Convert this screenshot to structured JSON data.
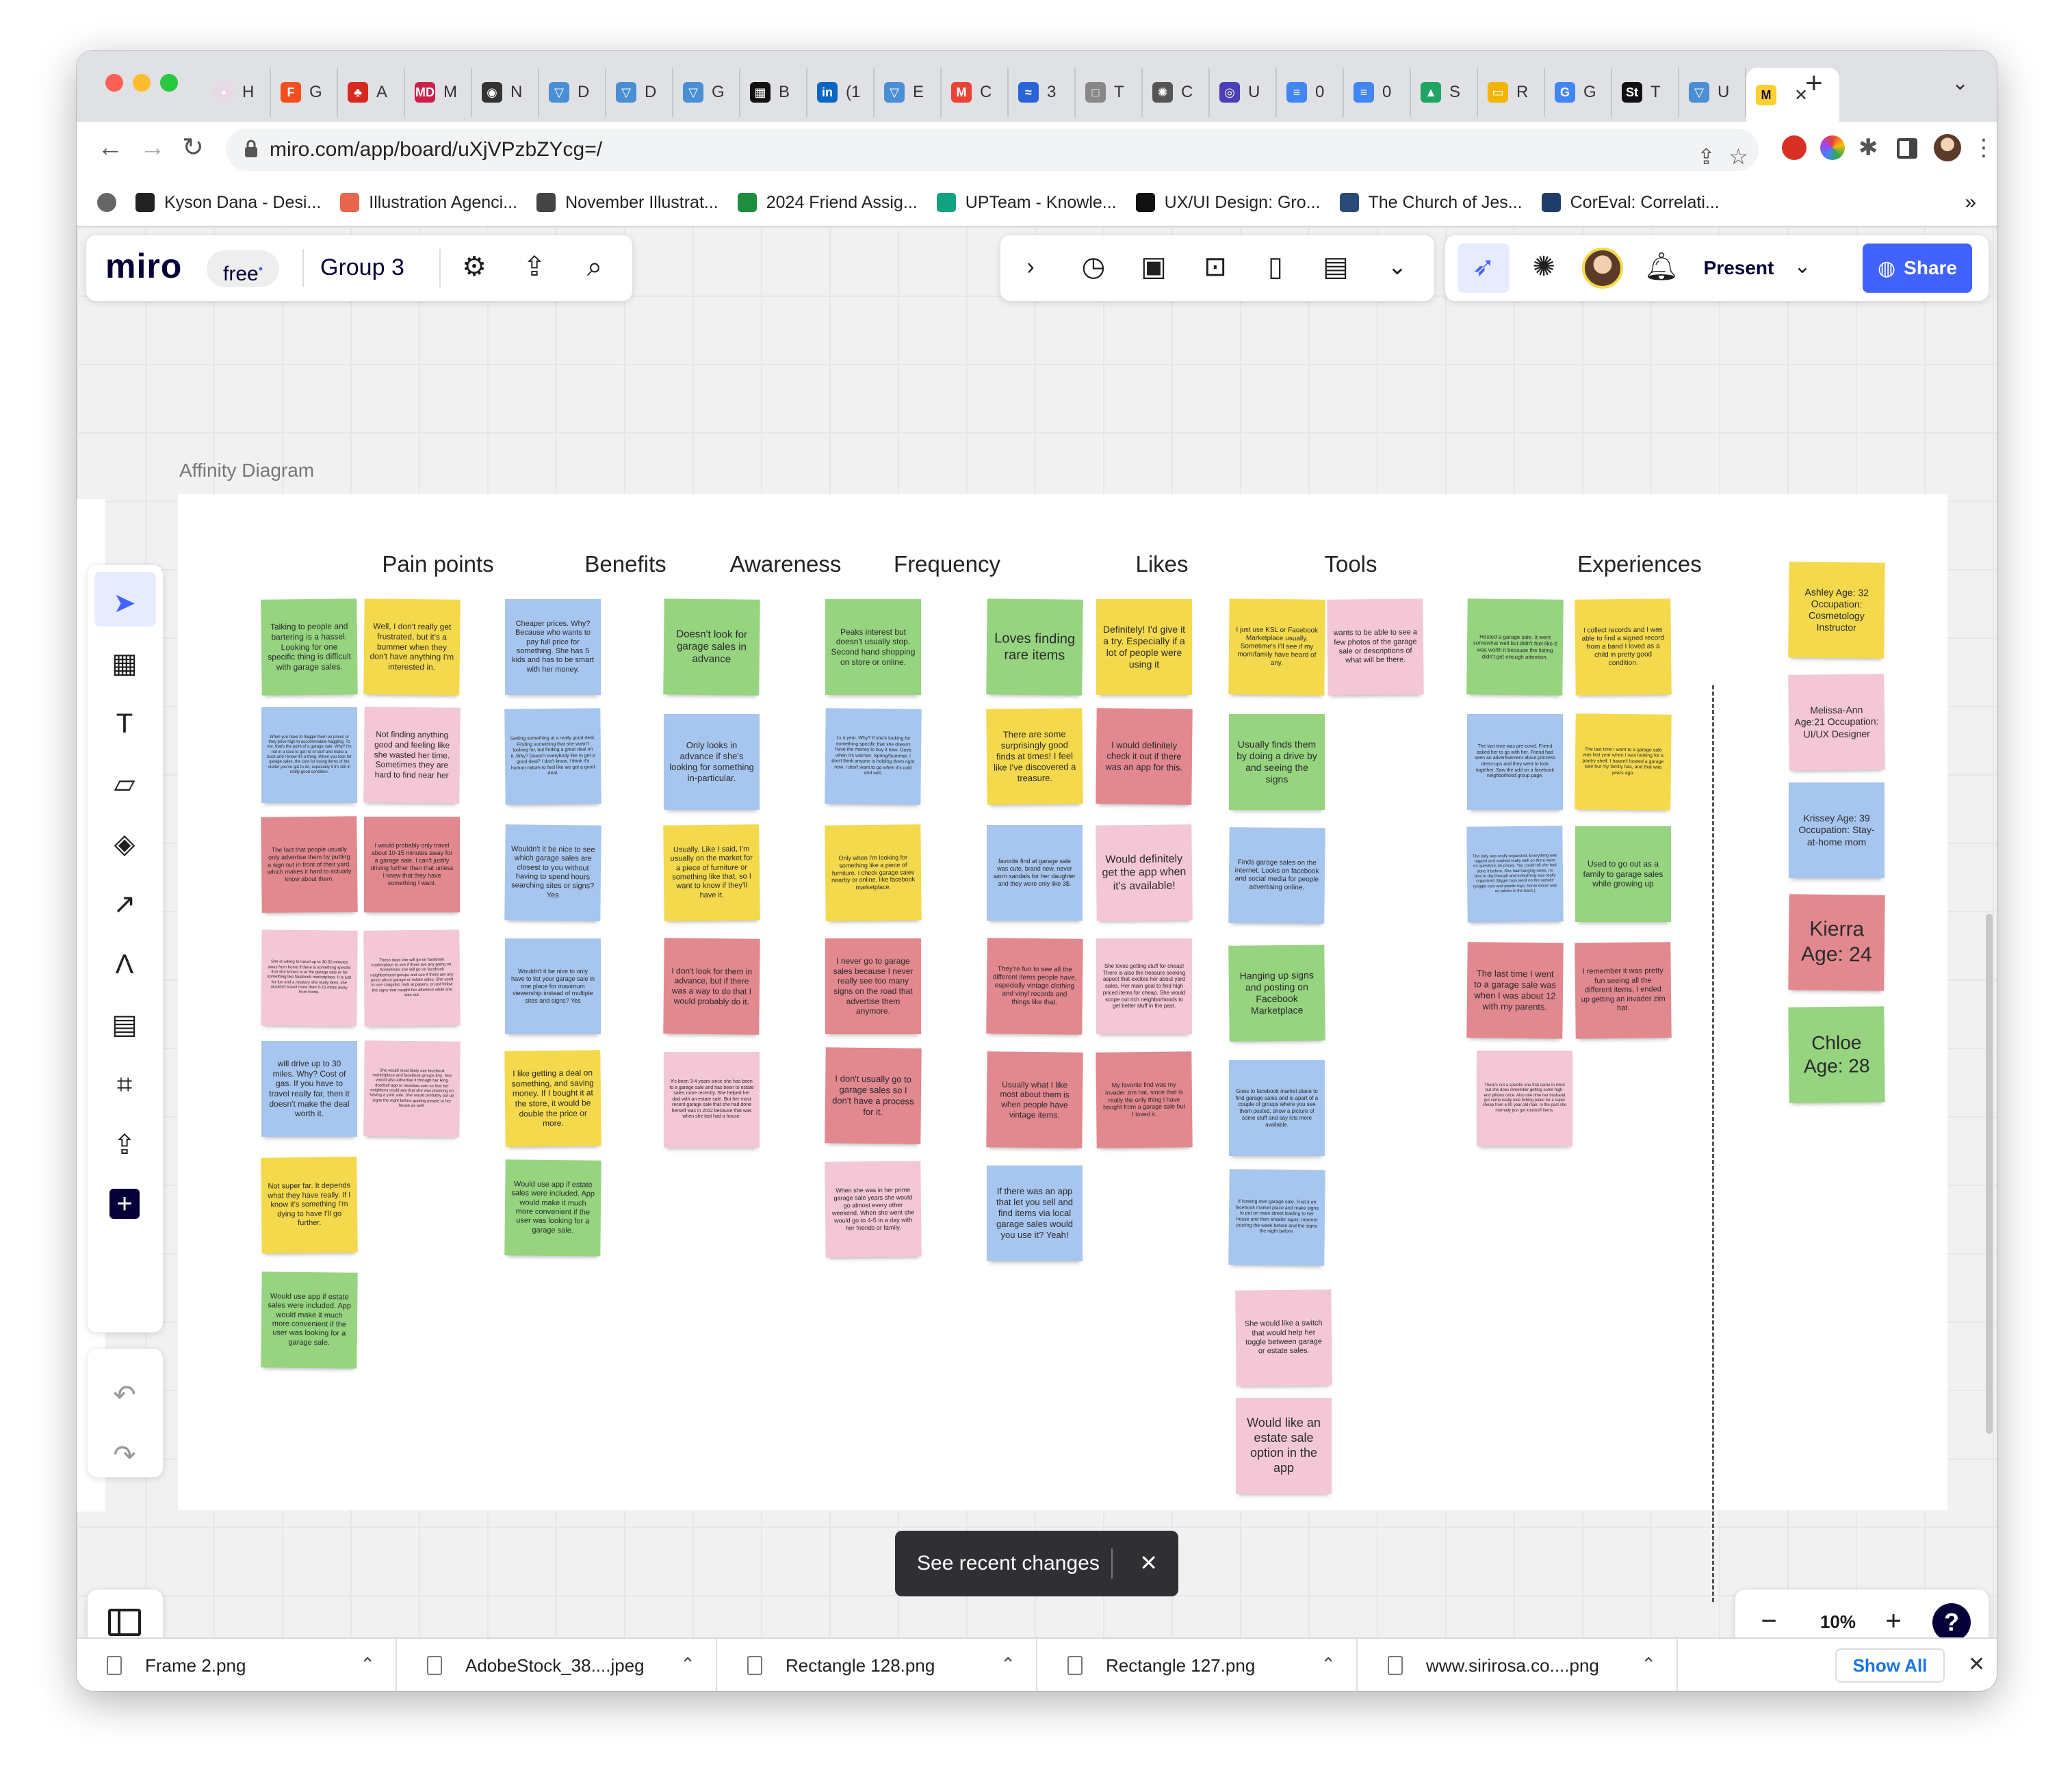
{
  "browser": {
    "tabs": [
      {
        "label": "H",
        "color": "#e7d9e8",
        "glyph": "▪"
      },
      {
        "label": "G",
        "color": "#f24e1e",
        "glyph": "F"
      },
      {
        "label": "A",
        "color": "#d52b1e",
        "glyph": "♣"
      },
      {
        "label": "M",
        "color": "#cc1f49",
        "glyph": "MD"
      },
      {
        "label": "N",
        "color": "#333333",
        "glyph": "◉"
      },
      {
        "label": "D",
        "color": "#4a8fd4",
        "glyph": "▽"
      },
      {
        "label": "D",
        "color": "#4a8fd4",
        "glyph": "▽"
      },
      {
        "label": "G",
        "color": "#4a8fd4",
        "glyph": "▽"
      },
      {
        "label": "B",
        "color": "#111111",
        "glyph": "▦"
      },
      {
        "label": "(1",
        "color": "#0a66c2",
        "glyph": "in"
      },
      {
        "label": "E",
        "color": "#4a8fd4",
        "glyph": "▽"
      },
      {
        "label": "C",
        "color": "#ea4335",
        "glyph": "M"
      },
      {
        "label": "3",
        "color": "#2864d8",
        "glyph": "≈"
      },
      {
        "label": "T",
        "color": "#888888",
        "glyph": "□"
      },
      {
        "label": "C",
        "color": "#555555",
        "glyph": "✺"
      },
      {
        "label": "U",
        "color": "#4b3fb6",
        "glyph": "◎"
      },
      {
        "label": "0",
        "color": "#4285f4",
        "glyph": "≡"
      },
      {
        "label": "0",
        "color": "#4285f4",
        "glyph": "≡"
      },
      {
        "label": "S",
        "color": "#1fa463",
        "glyph": "▲"
      },
      {
        "label": "R",
        "color": "#f4b400",
        "glyph": "▭"
      },
      {
        "label": "G",
        "color": "#4285f4",
        "glyph": "G"
      },
      {
        "label": "T",
        "color": "#111111",
        "glyph": "St"
      },
      {
        "label": "U",
        "color": "#4a8fd4",
        "glyph": "▽"
      }
    ],
    "url": "miro.com/app/board/uXjVPzbZYcg=/",
    "bookmarks": [
      {
        "label": "Kyson Dana - Desi...",
        "color": "#222222"
      },
      {
        "label": "Illustration Agenci...",
        "color": "#e8664d"
      },
      {
        "label": "November Illustrat...",
        "color": "#444444"
      },
      {
        "label": "2024 Friend Assig...",
        "color": "#1e8e3e"
      },
      {
        "label": "UPTeam - Knowle...",
        "color": "#11a37f"
      },
      {
        "label": "UX/UI Design: Gro...",
        "color": "#111111"
      },
      {
        "label": "The Church of Jes...",
        "color": "#2a4a7a"
      },
      {
        "label": "CorEval: Correlati...",
        "color": "#1f3d6b"
      }
    ]
  },
  "miro": {
    "logo": "miro",
    "plan": "free",
    "board_name": "Group 3",
    "present_label": "Present",
    "share_label": "Share",
    "share_color": "#4262ff",
    "zoom": "10%",
    "help": "?"
  },
  "board": {
    "frame_title": "Affinity Diagram",
    "columns": [
      "Pain points",
      "Benefits",
      "Awareness",
      "Frequency",
      "Likes",
      "Tools",
      "Experiences"
    ],
    "notes": [
      {
        "c": "g",
        "t": "Talking to people and bartering is a hassel. Looking for one specific thing is difficult with garage sales."
      },
      {
        "c": "y",
        "t": "Well, I don't really get frustrated, but it's a bummer when they don't have anything I'm interested in."
      },
      {
        "c": "b",
        "t": "When you have to haggle them on prices or they price high to accommodate haggling. To me, that's the point of a garage sale. Why? I'm not in a race to get rid of stuff and make a buck and I know it's a thing. When you look for garage sales, the cost for losing items of the clutter you've got to do, especially if it's still in really good condition."
      },
      {
        "c": "p",
        "t": "Not finding anything good and feeling like she wasted her time. Sometimes they are hard to find near her"
      },
      {
        "c": "r",
        "t": "The fact that people usually only advertise them by putting a sign out in front of their yard, which makes it hard to actually know about them."
      },
      {
        "c": "r",
        "t": "I would probably only travel about 10-15 minutes away for a garage sale, I can't justify driving further than that unless I knew that they have something I want."
      },
      {
        "c": "p",
        "t": "She is willing to travel up to 30-50 minutes away from home if there is something specific that she knows is at the garage sale or for something like facebook marketplace. It is just for fun and a mystery she really likes, she wouldn't travel more than 5-15 miles away from home."
      },
      {
        "c": "p",
        "t": "These days she will go on facebook marketplace to see if there are any going on. Sometimes she will go on facebook neighborhood groups and see if there are any posts about garage or estate sales. She used to use craigslist, look at papers, or just follow the signs that caught her attention while she was out."
      },
      {
        "c": "b",
        "t": "will drive up to 30 miles. Why? Cost of gas. If you have to travel really far, then it doesn't make the deal worth it."
      },
      {
        "c": "p",
        "t": "She would most likely use facebook marketplace and facebook groups first. She would also advertise it through her Ring doorbell app or nextdoor.com so that her neighbors could see that she was planning on having a yard sale. She would probably put up signs the night before guiding people to her house as well."
      },
      {
        "c": "y",
        "t": "Not super far. It depends what they have really. If I know it's something I'm dying to have I'll go further."
      },
      {
        "c": "g",
        "t": "Would use app if estate sales were included. App would make it much more convenient if the user was looking for a garage sale."
      },
      {
        "c": "b",
        "t": "Cheaper prices. Why? Because who wants to pay full price for something. She has 5 kids and has to be smart with her money."
      },
      {
        "c": "b",
        "t": "Getting something at a really good deal. Finding something that she wasn't looking for, but finding a great deal on it. Why? Doesn't everybody like to get a good deal? I don't know. I think it's human nature to feel like we got a good deal."
      },
      {
        "c": "b",
        "t": "Wouldn't it be nice to see which garage sales are closest to you without having to spend hours searching sites or signs? Yes"
      },
      {
        "c": "b",
        "t": "Wouldn't it be nice to only have to list your garage sale in one place for maximum viewership instead of multiple sites and signs? Yes"
      },
      {
        "c": "y",
        "t": "I like getting a deal on something, and saving money. If I bought it at the store, it would be double the price or more."
      },
      {
        "c": "g",
        "t": "Would use app if estate sales were included. App would make it much more convenient if the user was looking for a garage sale."
      },
      {
        "c": "g",
        "t": "Doesn't look for garage sales in advance"
      },
      {
        "c": "b",
        "t": "Only looks in advance if she's looking for something in-particular."
      },
      {
        "c": "y",
        "t": "Usually. Like I said, I'm usually on the market for a piece of furniture or something like that, so I want to know if they'll have it."
      },
      {
        "c": "r",
        "t": "I don't look for them in advance, but if there was a way to do that I would probably do it."
      },
      {
        "c": "p",
        "t": "It's been 3-4 years since she has been to a garage sale and has been to estate sales more recently. She helped her dad with an estate sale. But her most recent garage sale that she had done herself was in 2012 because that was when she last had a house."
      },
      {
        "c": "g",
        "t": "Peaks interest but doesn't usually stop. Second hand shopping on store or online."
      },
      {
        "c": "b",
        "t": "1x a year. Why? If she's looking for something specific that she doesn't have the money to buy it new. Goes when it's warmer. Spring/Summer. I don't think anyone is holding them right now. I don't want to go when it's cold and wet."
      },
      {
        "c": "y",
        "t": "Only when I'm looking for something like a piece of furniture. I check garage sales nearby or online, like facebook marketplace."
      },
      {
        "c": "r",
        "t": "I never go to garage sales because I never really see too many signs on the road that advertise them anymore."
      },
      {
        "c": "r",
        "t": "I don't usually go to garage sales so I don't have a process for it."
      },
      {
        "c": "p",
        "t": "When she was in her prime garage sale years she would go almost every other weekend. When she went she would go to 4-5 in a day with her friends or family."
      },
      {
        "c": "g",
        "t": "Loves finding rare items"
      },
      {
        "c": "y",
        "t": "Definitely! I'd give it a try. Especially if a lot of people were using it"
      },
      {
        "c": "y",
        "t": "There are some surprisingly good finds at times! I feel like I've discovered a treasure."
      },
      {
        "c": "r",
        "t": "I would definitely check it out if there was an app for this."
      },
      {
        "c": "b",
        "t": "favorite find at garage sale was cute, brand new, never worn sandals for her daughter and they were only like 3$."
      },
      {
        "c": "p",
        "t": "Would definitely get the app when it's available!"
      },
      {
        "c": "r",
        "t": "They're fun to see all the different items people have, especially vintage clothing and vinyl records and things like that."
      },
      {
        "c": "p",
        "t": "She loves getting stuff for cheap! There is also the treasure seeking aspect that excites her about yard sales. Her main goal to find high priced items for cheap. She would scope out rich neighborhoods to get better stuff in the past."
      },
      {
        "c": "r",
        "t": "Usually what I like most about them is when people have vintage items."
      },
      {
        "c": "r",
        "t": "My favorite find was my invader zim hat, since that is really the only thing I have bought from a garage sale but I loved it."
      },
      {
        "c": "b",
        "t": "If there was an app that let you sell and find items via local garage sales would you use it? Yeah!"
      },
      {
        "c": "y",
        "t": "I just use KSL or Facebook Marketplace usually. Sometime's I'll see if my mom/family have heard of any."
      },
      {
        "c": "p",
        "t": "wants to be able to see a few photos of the garage sale or descriptions of what will be there."
      },
      {
        "c": "g",
        "t": "Usually finds them by doing a drive by and seeing the signs"
      },
      {
        "c": "b",
        "t": "Finds garage sales on the internet. Looks on facebook and social media for people advertising online."
      },
      {
        "c": "g",
        "t": "Hanging up signs and posting on Facebook Marketplace"
      },
      {
        "c": "b",
        "t": "Goes to facebook market place to find garage sales and is apart of a couple of groups where you see them posted, show a picture of some stuff and say lots more available."
      },
      {
        "c": "b",
        "t": "If hosting own garage sale. First it on facebook market place and make signs to put on main street leading to her house and then smaller signs. Internet posting the week before and the signs the night before."
      },
      {
        "c": "p",
        "t": "She would like a switch that would help her toggle between garage or estate sales."
      },
      {
        "c": "p",
        "t": "Would like an estate sale option in the app"
      },
      {
        "c": "g",
        "t": "Hosted a garage sale. It went somewhat well but didn't feel like it was worth it because the listing didn't get enough attention."
      },
      {
        "c": "y",
        "t": "I collect records and I was able to find a signed record from a band I loved as a child in pretty good condition."
      },
      {
        "c": "b",
        "t": "The last time was pre-covid. Friend asked her to go with her. Friend had seen an advertisement about princess dress-ups and they went to look together. Saw the add on a facebook neighborhood group page."
      },
      {
        "c": "y",
        "t": "The last time I went to a garage sale was last year when I was looking for a pantry shelf. I haven't hosted a garage sale but my family has, and that was years ago."
      },
      {
        "c": "b",
        "t": "The lady was really organized. Everything was tagged and marked really well so there were no questions on prices. You could tell she had done it before. She had hanging racks, no bins to dig through and everything was really organized. Bigger toys went on the outside (wiggle cars and plastic toys, home decor was on tables in the back.)"
      },
      {
        "c": "g",
        "t": "Used to go out as a family to garage sales while growing up"
      },
      {
        "c": "r",
        "t": "The last time I went to a garage sale was when I was about 12 with my parents."
      },
      {
        "c": "r",
        "t": "I remember it was pretty fun seeing all the different items, I ended up getting an invader zim hat."
      },
      {
        "c": "p",
        "t": "There's not a specific one that came to mind but she does remember getting some high-end pillows once. Also one time her husband got some really nice fishing poles for a super cheap from a 90 year old man. In the past she normally just got knockoff items."
      },
      {
        "c": "y",
        "t": "Ashley Age: 32 Occupation: Cosmetology Instructor"
      },
      {
        "c": "p",
        "t": "Melissa-Ann Age:21 Occupation: UI/UX Designer"
      },
      {
        "c": "b",
        "t": "Krissey Age: 39 Occupation: Stay-at-home mom"
      },
      {
        "c": "r",
        "t": "Kierra Age: 24"
      },
      {
        "c": "g",
        "t": "Chloe Age: 28"
      }
    ]
  },
  "toast": {
    "text": "See recent changes",
    "close": "✕"
  },
  "downloads": {
    "items": [
      "Frame 2.png",
      "AdobeStock_38....jpeg",
      "Rectangle 128.png",
      "Rectangle 127.png",
      "www.sirirosa.co....png"
    ],
    "show_all": "Show All"
  },
  "icons": {
    "select-icon": "➤",
    "templates-icon": "▦",
    "text-icon": "T",
    "sticky-note-icon": "▱",
    "shapes-icon": "◈",
    "arrow-icon": "↗",
    "pen-icon": "Λ",
    "comment-icon": "▤",
    "frame-icon": "⌗",
    "upload-icon": "⇪",
    "more-apps-icon": "+",
    "undo-icon": "↶",
    "redo-icon": "↷"
  }
}
